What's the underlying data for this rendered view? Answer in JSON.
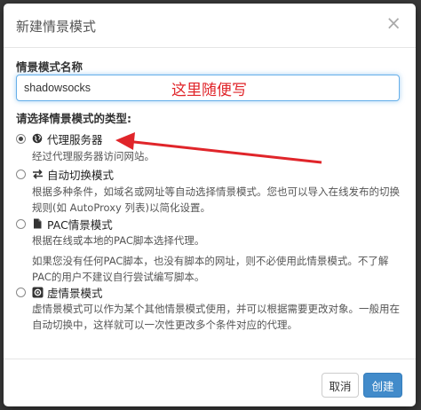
{
  "background": {
    "text": "shadowsocks"
  },
  "dialog": {
    "title": "新建情景模式",
    "close_symbol": "×",
    "name_label": "情景模式名称",
    "name_value": "shadowsocks",
    "annotation": "这里随便写",
    "type_label": "请选择情景模式的类型:",
    "options": [
      {
        "label": "代理服务器",
        "icon": "globe-icon",
        "checked": true,
        "desc": "经过代理服务器访问网站。"
      },
      {
        "label": "自动切换模式",
        "icon": "switch-icon",
        "checked": false,
        "desc": "根据多种条件，如域名或网址等自动选择情景模式。您也可以导入在线发布的切换规则(如 AutoProxy 列表)以简化设置。"
      },
      {
        "label": "PAC情景模式",
        "icon": "file-icon",
        "checked": false,
        "desc": "根据在线或本地的PAC脚本选择代理。",
        "desc2": "如果您没有任何PAC脚本，也没有脚本的网址，则不必使用此情景模式。不了解PAC的用户不建议自行尝试编写脚本。"
      },
      {
        "label": "虚情景模式",
        "icon": "virtual-icon",
        "checked": false,
        "desc": "虚情景模式可以作为某个其他情景模式使用，并可以根据需要更改对象。一般用在自动切换中，这样就可以一次性更改多个条件对应的代理。"
      }
    ],
    "cancel_label": "取消",
    "create_label": "创建"
  },
  "colors": {
    "accent": "#428bca",
    "annotation": "#e0252a"
  }
}
